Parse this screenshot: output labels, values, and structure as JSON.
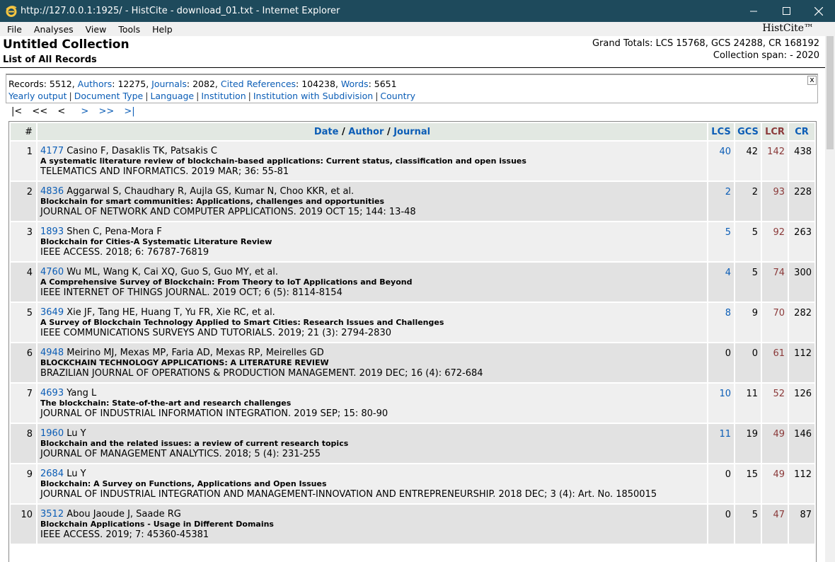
{
  "window": {
    "title": "http://127.0.0.1:1925/ - HistCite - download_01.txt - Internet Explorer"
  },
  "menu": {
    "items": [
      "File",
      "Analyses",
      "View",
      "Tools",
      "Help"
    ],
    "brand": "HistCite™"
  },
  "header": {
    "collection_title": "Untitled Collection",
    "subtitle": "List of All Records",
    "grand_totals": "Grand Totals: LCS 15768, GCS 24288, CR 168192",
    "collection_span": "Collection span: - 2020"
  },
  "stats": {
    "records_label": "Records",
    "records_value": "5512",
    "authors_label": "Authors",
    "authors_value": "12275",
    "journals_label": "Journals",
    "journals_value": "2082",
    "cited_label": "Cited References",
    "cited_value": "104238",
    "words_label": "Words",
    "words_value": "5651",
    "links": [
      "Yearly output",
      "Document Type",
      "Language",
      "Institution",
      "Institution with Subdivision",
      "Country"
    ],
    "close": "x"
  },
  "pager": [
    "|<",
    "<<",
    "<",
    ">",
    ">>",
    ">|"
  ],
  "table": {
    "headers": {
      "num": "#",
      "date": "Date",
      "author": "Author",
      "journal": "Journal",
      "slash": "/",
      "lcs": "LCS",
      "gcs": "GCS",
      "lcr": "LCR",
      "cr": "CR"
    },
    "rows": [
      {
        "num": "1",
        "id": "4177",
        "authors": "Casino F, Dasaklis TK, Patsakis C",
        "title": "A systematic literature review of blockchain-based applications: Current status, classification and open issues",
        "source": "TELEMATICS AND INFORMATICS. 2019 MAR; 36: 55-81",
        "lcs": "40",
        "gcs": "42",
        "lcr": "142",
        "cr": "438"
      },
      {
        "num": "2",
        "id": "4836",
        "authors": "Aggarwal S, Chaudhary R, Aujla GS, Kumar N, Choo KKR, et al.",
        "title": "Blockchain for smart communities: Applications, challenges and opportunities",
        "source": "JOURNAL OF NETWORK AND COMPUTER APPLICATIONS. 2019 OCT 15; 144: 13-48",
        "lcs": "2",
        "gcs": "2",
        "lcr": "93",
        "cr": "228"
      },
      {
        "num": "3",
        "id": "1893",
        "authors": "Shen C, Pena-Mora F",
        "title": "Blockchain for Cities-A Systematic Literature Review",
        "source": "IEEE ACCESS. 2018; 6: 76787-76819",
        "lcs": "5",
        "gcs": "5",
        "lcr": "92",
        "cr": "263"
      },
      {
        "num": "4",
        "id": "4760",
        "authors": "Wu ML, Wang K, Cai XQ, Guo S, Guo MY, et al.",
        "title": "A Comprehensive Survey of Blockchain: From Theory to IoT Applications and Beyond",
        "source": "IEEE INTERNET OF THINGS JOURNAL. 2019 OCT; 6 (5): 8114-8154",
        "lcs": "4",
        "gcs": "5",
        "lcr": "74",
        "cr": "300"
      },
      {
        "num": "5",
        "id": "3649",
        "authors": "Xie JF, Tang HE, Huang T, Yu FR, Xie RC, et al.",
        "title": "A Survey of Blockchain Technology Applied to Smart Cities: Research Issues and Challenges",
        "source": "IEEE COMMUNICATIONS SURVEYS AND TUTORIALS. 2019; 21 (3): 2794-2830",
        "lcs": "8",
        "gcs": "9",
        "lcr": "70",
        "cr": "282"
      },
      {
        "num": "6",
        "id": "4948",
        "authors": "Meirino MJ, Mexas MP, Faria AD, Mexas RP, Meirelles GD",
        "title": "BLOCKCHAIN TECHNOLOGY APPLICATIONS: A LITERATURE REVIEW",
        "source": "BRAZILIAN JOURNAL OF OPERATIONS & PRODUCTION MANAGEMENT. 2019 DEC; 16 (4): 672-684",
        "lcs": "0",
        "gcs": "0",
        "lcr": "61",
        "cr": "112"
      },
      {
        "num": "7",
        "id": "4693",
        "authors": "Yang L",
        "title": "The blockchain: State-of-the-art and research challenges",
        "source": "JOURNAL OF INDUSTRIAL INFORMATION INTEGRATION. 2019 SEP; 15: 80-90",
        "lcs": "10",
        "gcs": "11",
        "lcr": "52",
        "cr": "126"
      },
      {
        "num": "8",
        "id": "1960",
        "authors": "Lu Y",
        "title": "Blockchain and the related issues: a review of current research topics",
        "source": "JOURNAL OF MANAGEMENT ANALYTICS. 2018; 5 (4): 231-255",
        "lcs": "11",
        "gcs": "19",
        "lcr": "49",
        "cr": "146"
      },
      {
        "num": "9",
        "id": "2684",
        "authors": "Lu Y",
        "title": "Blockchain: A Survey on Functions, Applications and Open Issues",
        "source": "JOURNAL OF INDUSTRIAL INTEGRATION AND MANAGEMENT-INNOVATION AND ENTREPRENEURSHIP. 2018 DEC; 3 (4): Art. No. 1850015",
        "lcs": "0",
        "gcs": "15",
        "lcr": "49",
        "cr": "112"
      },
      {
        "num": "10",
        "id": "3512",
        "authors": "Abou Jaoude J, Saade RG",
        "title": "Blockchain Applications - Usage in Different Domains",
        "source": "IEEE ACCESS. 2019; 7: 45360-45381",
        "lcs": "0",
        "gcs": "5",
        "lcr": "47",
        "cr": "87"
      }
    ]
  }
}
